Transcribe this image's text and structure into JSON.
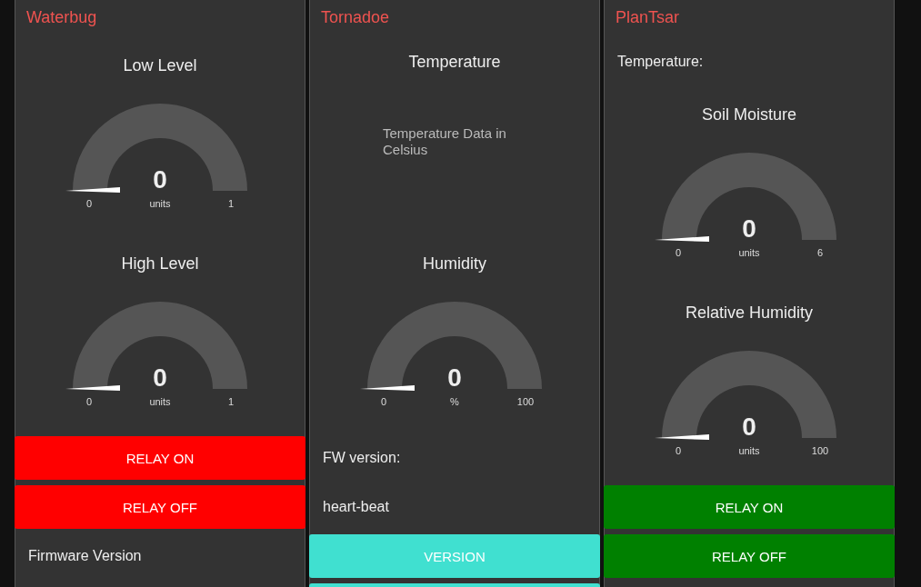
{
  "groups": [
    {
      "title": "Waterbug",
      "widgets": [
        {
          "kind": "gauge",
          "title": "Low Level",
          "value": "0",
          "units": "units",
          "min": "0",
          "max": "1"
        },
        {
          "kind": "gauge",
          "title": "High Level",
          "value": "0",
          "units": "units",
          "min": "0",
          "max": "1"
        },
        {
          "kind": "button",
          "label": "RELAY ON",
          "color": "#ff0000"
        },
        {
          "kind": "button",
          "label": "RELAY OFF",
          "color": "#ff0000"
        },
        {
          "kind": "text",
          "label": "Firmware Version"
        }
      ]
    },
    {
      "title": "Tornadoe",
      "widgets": [
        {
          "kind": "panel",
          "title": "Temperature",
          "text": "Temperature Data in Celsius"
        },
        {
          "kind": "gauge",
          "title": "Humidity",
          "value": "0",
          "units": "%",
          "min": "0",
          "max": "100"
        },
        {
          "kind": "text",
          "label": "FW version:"
        },
        {
          "kind": "text",
          "label": "heart-beat"
        },
        {
          "kind": "button",
          "label": "VERSION",
          "color": "#40e0d0"
        },
        {
          "kind": "button",
          "color": "#40e0d0"
        }
      ]
    },
    {
      "title": "PlanTsar",
      "widgets": [
        {
          "kind": "text",
          "label": "Temperature:"
        },
        {
          "kind": "gauge",
          "title": "Soil Moisture",
          "value": "0",
          "units": "units",
          "min": "0",
          "max": "6"
        },
        {
          "kind": "gauge",
          "title": "Relative Humidity",
          "value": "0",
          "units": "units",
          "min": "0",
          "max": "100"
        },
        {
          "kind": "button",
          "label": "RELAY ON",
          "color": "#008000"
        },
        {
          "kind": "button",
          "label": "RELAY OFF",
          "color": "#008000"
        }
      ]
    }
  ]
}
